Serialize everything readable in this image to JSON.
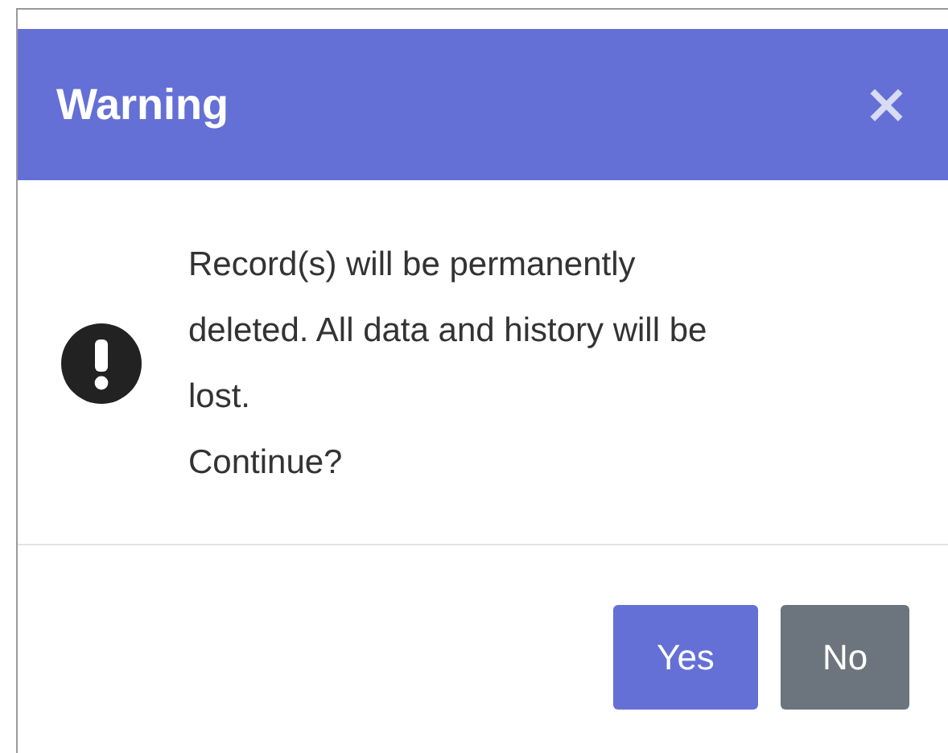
{
  "dialog": {
    "title": "Warning",
    "close": "×",
    "message_lines": [
      "Record(s) will be permanently",
      "deleted. All data and history will be",
      "lost.",
      "Continue?"
    ],
    "buttons": [
      {
        "label": "Yes",
        "kind": "primary"
      },
      {
        "label": "No",
        "kind": "secondary"
      }
    ]
  }
}
